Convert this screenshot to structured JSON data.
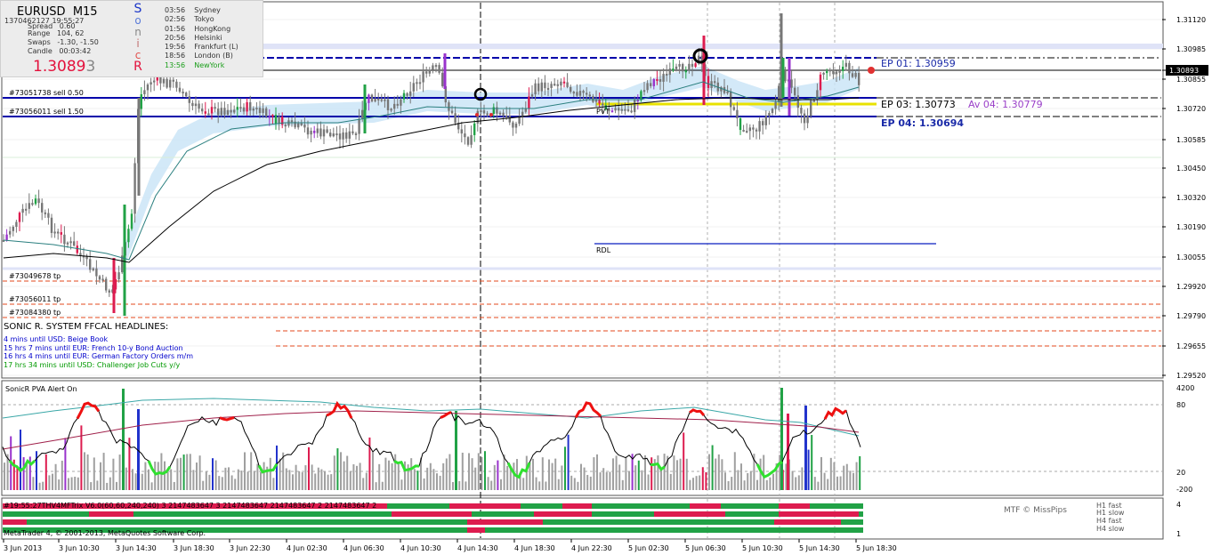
{
  "symbol": "EURUSD",
  "timeframe": "M15",
  "colors": {
    "bull": "#21a246",
    "bear": "#dd1c4f",
    "neutral": "#777777",
    "band": "#cbe5f7",
    "hline_blue": "#0000aa",
    "hline_red": "#e34a1d",
    "yellow": "#e8e200",
    "rdl": "#3344cc",
    "green_pva": "#30e030",
    "red_pva": "#ee1111",
    "blue_bar": "#2233cc",
    "purple_bar": "#9933cc"
  },
  "info_panel": {
    "timestamp": "1370462127 19:55:27",
    "spread": "Spread   0.60",
    "range": "Range   104, 62",
    "swaps": "Swaps   -1.30, -1.50",
    "candle": "Candle   00:03:42",
    "price_main": "1.3089",
    "price_last": "3",
    "sonicr_letters": [
      "S",
      "o",
      "n",
      "i",
      "c",
      "R"
    ],
    "sessions": [
      {
        "time": "03:56",
        "name": "Sydney"
      },
      {
        "time": "02:56",
        "name": "Tokyo"
      },
      {
        "time": "01:56",
        "name": "HongKong"
      },
      {
        "time": "20:56",
        "name": "Helsinki"
      },
      {
        "time": "19:56",
        "name": "Frankfurt  (L)"
      },
      {
        "time": "18:56",
        "name": "London  (B)"
      },
      {
        "time": "13:56",
        "name": "NewYork"
      }
    ]
  },
  "trade_labels": {
    "sell1": "#73051738 sell 0.50",
    "sell2": "#73056011 sell 1.50",
    "tp1": "#73049678 tp",
    "tp2": "#73056011 tp",
    "tp3": "#73084380 tp"
  },
  "ep_labels": {
    "ep01": "EP 01:  1.30959",
    "ep03": "EP 03:  1.30773",
    "av04": "Av 04:  1.30779",
    "ep04": "EP 04:  1.30694",
    "pvt": "PVT",
    "rdl": "RDL"
  },
  "headlines": {
    "title": "SONIC R. SYSTEM  FFCAL HEADLINES:",
    "items": [
      {
        "text": "4 mins until USD: Beige Book",
        "color": "#0000cc"
      },
      {
        "text": "15 hrs 7 mins until EUR: French 10-y Bond Auction",
        "color": "#0000cc"
      },
      {
        "text": "16 hrs 4 mins until EUR: German Factory Orders m/m",
        "color": "#0000cc"
      },
      {
        "text": "17 hrs 34 mins until USD: Challenger Job Cuts y/y",
        "color": "#009900"
      }
    ]
  },
  "price_axis": {
    "labels": [
      "1.31120",
      "1.30985",
      "1.30893",
      "1.30855",
      "1.30720",
      "1.30585",
      "1.30450",
      "1.30320",
      "1.30190",
      "1.30055",
      "1.29920",
      "1.29790",
      "1.29655",
      "1.29520"
    ],
    "current": "1.30893"
  },
  "pva_panel": {
    "title": "SonicR PVA   Alert On",
    "scale": [
      "4200",
      "80",
      "20",
      "-200"
    ]
  },
  "mtf_panel": {
    "header": "#19:55:27THV4MFTrix V6.0(60,60,240,240) 3 2147483647 3 2147483647 2147483647 2 2147483647 2",
    "credit": "MTF © MissPips",
    "rows": [
      "H1 fast",
      "H1 slow",
      "H4 fast",
      "H4 slow"
    ],
    "scale": [
      "4",
      "1"
    ],
    "copyright": "MetaTrader 4, © 2001-2013, MetaQuotes Software Corp."
  },
  "time_axis": [
    "3 Jun 2013",
    "3 Jun 10:30",
    "3 Jun 14:30",
    "3 Jun 18:30",
    "3 Jun 22:30",
    "4 Jun 02:30",
    "4 Jun 06:30",
    "4 Jun 10:30",
    "4 Jun 14:30",
    "4 Jun 18:30",
    "4 Jun 22:30",
    "5 Jun 02:30",
    "5 Jun 06:30",
    "5 Jun 10:30",
    "5 Jun 14:30",
    "5 Jun 18:30"
  ]
}
